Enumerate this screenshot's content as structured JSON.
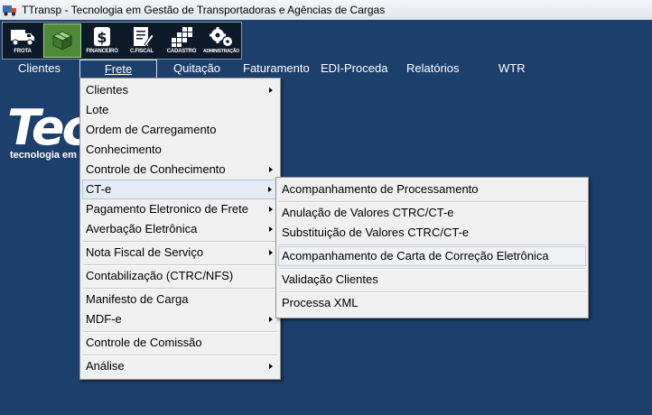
{
  "window": {
    "title": "TTransp - Tecnologia em Gestão de Transportadoras e Agências de Cargas",
    "icon": "truck-icon"
  },
  "toolbar": {
    "buttons": [
      {
        "name": "frota",
        "label": "FROTA",
        "icon": "truck-icon"
      },
      {
        "name": "frete",
        "label": "",
        "icon": "cargo-box-icon",
        "active": true
      },
      {
        "name": "financeiro",
        "label": "FINANCEIRO",
        "icon": "dollar-icon"
      },
      {
        "name": "c-fiscal",
        "label": "C.FISCAL",
        "icon": "document-pencil-icon"
      },
      {
        "name": "cadastro",
        "label": "CADASTRO",
        "icon": "grid-icon"
      },
      {
        "name": "administracao",
        "label": "ADMINISTRAÇÃO",
        "icon": "gears-icon"
      }
    ]
  },
  "menubar": {
    "clientes": "Clientes",
    "frete": "Frete",
    "quitacao": "Quitação",
    "faturamento": "Faturamento",
    "edi": "EDI-Proceda",
    "relatorios": "Relatórios",
    "wtr": "WTR"
  },
  "logo": {
    "big": "Tec",
    "small": "tecnologia em"
  },
  "frete_menu": {
    "items": [
      {
        "label": "Clientes",
        "submenu": true
      },
      {
        "label": "Lote"
      },
      {
        "label": "Ordem de Carregamento"
      },
      {
        "label": "Conhecimento"
      },
      {
        "label": "Controle de Conhecimento",
        "submenu": true
      },
      {
        "label": "CT-e",
        "submenu": true,
        "highlighted": true
      },
      {
        "label": "Pagamento Eletronico de Frete",
        "submenu": true
      },
      {
        "label": "Averbação Eletrônica",
        "submenu": true
      },
      {
        "label": "Nota Fiscal de Serviço",
        "submenu": true
      },
      {
        "label": "Contabilização (CTRC/NFS)"
      },
      {
        "label": "Manifesto de Carga"
      },
      {
        "label": "MDF-e",
        "submenu": true
      },
      {
        "label": "Controle de Comissão"
      },
      {
        "label": "Análise",
        "submenu": true
      }
    ]
  },
  "cte_submenu": {
    "items": [
      {
        "label": "Acompanhamento de Processamento"
      },
      {
        "label": "Anulação de Valores CTRC/CT-e"
      },
      {
        "label": "Substituição de Valores CTRC/CT-e"
      },
      {
        "label": "Acompanhamento de Carta de Correção Eletrônica",
        "highlighted": true
      },
      {
        "label": "Validação Clientes"
      },
      {
        "label": "Processa XML"
      }
    ]
  },
  "colors": {
    "background": "#1c3f6c",
    "menu_bg": "#f0f0f0",
    "active_tool": "#4e8a3a"
  }
}
